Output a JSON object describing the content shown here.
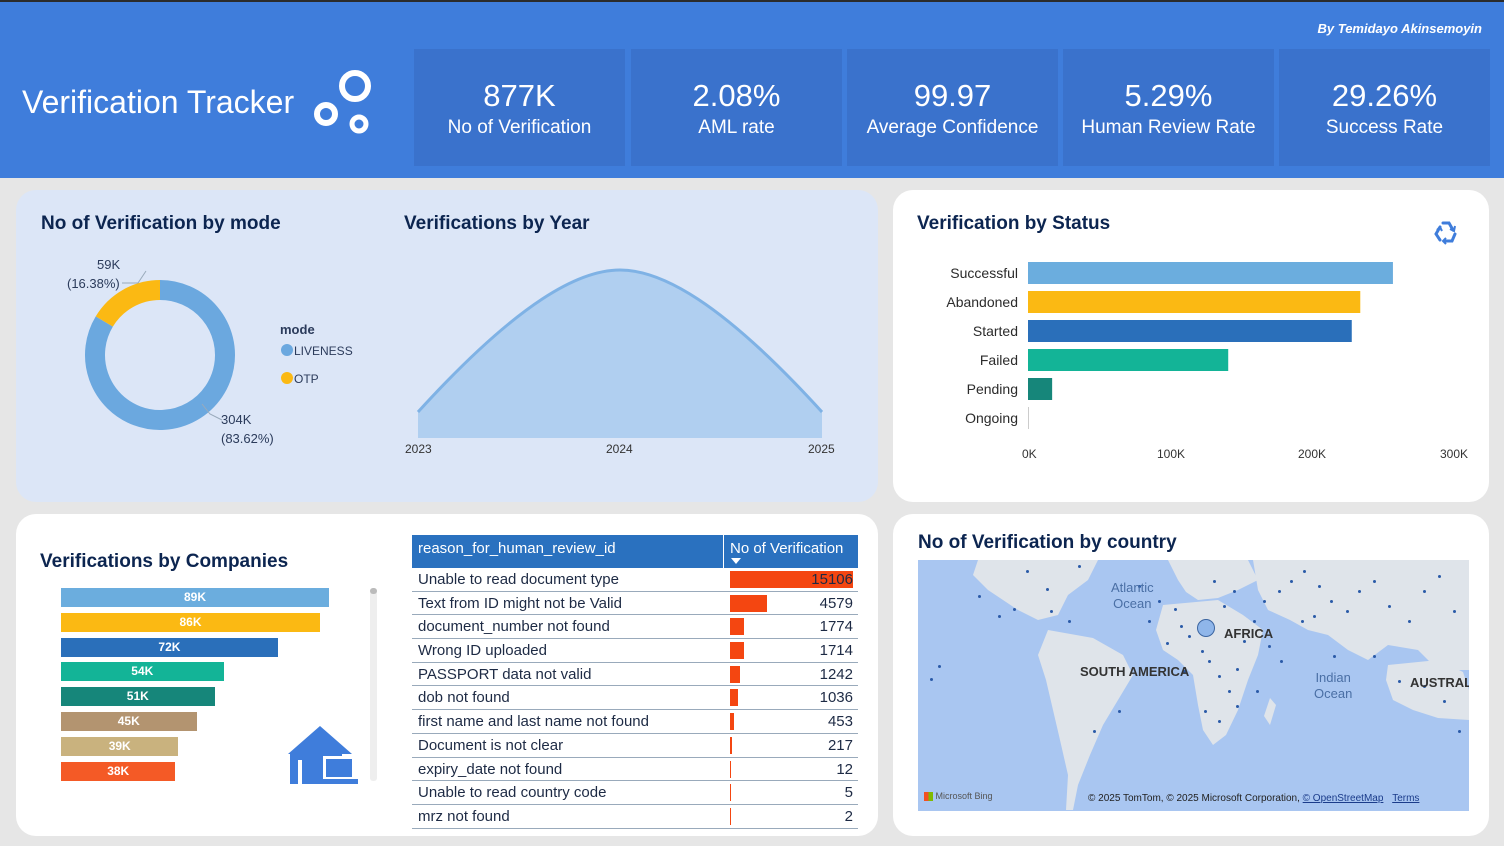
{
  "header": {
    "title": "Verification Tracker",
    "author": "By Temidayo Akinsemoyin",
    "kpis": [
      {
        "value": "877K",
        "label": "No of Verification"
      },
      {
        "value": "2.08%",
        "label": "AML rate"
      },
      {
        "value": "99.97",
        "label": "Average Confidence"
      },
      {
        "value": "5.29%",
        "label": "Human Review Rate"
      },
      {
        "value": "29.26%",
        "label": "Success Rate"
      }
    ]
  },
  "mode_chart": {
    "title": "No of Verification by mode",
    "legend_title": "mode",
    "slices": [
      {
        "name": "LIVENESS",
        "value_label": "304K",
        "pct_label": "(83.62%)",
        "pct": 83.62,
        "color": "#6ba8df"
      },
      {
        "name": "OTP",
        "value_label": "59K",
        "pct_label": "(16.38%)",
        "pct": 16.38,
        "color": "#fbb913"
      }
    ]
  },
  "year_chart": {
    "title": "Verifications by Year",
    "x_labels": [
      "2023",
      "2024",
      "2025"
    ],
    "color": "#7fb2e5"
  },
  "status_chart": {
    "title": "Verification by Status",
    "x_ticks": [
      "0K",
      "100K",
      "200K",
      "300K"
    ],
    "xlim": [
      0,
      300000
    ],
    "bars": [
      {
        "label": "Successful",
        "value": 257000,
        "color": "#6badde"
      },
      {
        "label": "Abandoned",
        "value": 234000,
        "color": "#fbb913"
      },
      {
        "label": "Started",
        "value": 228000,
        "color": "#2a6fba"
      },
      {
        "label": "Failed",
        "value": 141000,
        "color": "#13b497"
      },
      {
        "label": "Pending",
        "value": 17000,
        "color": "#16867a"
      },
      {
        "label": "Ongoing",
        "value": 300,
        "color": "#cccccc"
      }
    ]
  },
  "company_chart": {
    "title": "Verifications by Companies",
    "max": 89,
    "bars": [
      {
        "label": "89K",
        "value": 89,
        "color": "#6badde"
      },
      {
        "label": "86K",
        "value": 86,
        "color": "#fbb913"
      },
      {
        "label": "72K",
        "value": 72,
        "color": "#2a6fba"
      },
      {
        "label": "54K",
        "value": 54,
        "color": "#13b497"
      },
      {
        "label": "51K",
        "value": 51,
        "color": "#16867a"
      },
      {
        "label": "45K",
        "value": 45,
        "color": "#b39470"
      },
      {
        "label": "39K",
        "value": 39,
        "color": "#c9b27e"
      },
      {
        "label": "38K",
        "value": 38,
        "color": "#f45a26"
      }
    ]
  },
  "review_table": {
    "col1": "reason_for_human_review_id",
    "col2": "No of Verification",
    "max": 15106,
    "rows": [
      {
        "reason": "Unable to read document type",
        "count": "15106",
        "value": 15106
      },
      {
        "reason": "Text from ID might not be Valid",
        "count": "4579",
        "value": 4579
      },
      {
        "reason": "document_number not found",
        "count": "1774",
        "value": 1774
      },
      {
        "reason": "Wrong ID uploaded",
        "count": "1714",
        "value": 1714
      },
      {
        "reason": "PASSPORT data not valid",
        "count": "1242",
        "value": 1242
      },
      {
        "reason": "dob not found",
        "count": "1036",
        "value": 1036
      },
      {
        "reason": "first name and last name not found",
        "count": "453",
        "value": 453
      },
      {
        "reason": "Document is not clear",
        "count": "217",
        "value": 217
      },
      {
        "reason": "expiry_date not found",
        "count": "12",
        "value": 12
      },
      {
        "reason": "Unable to read country code",
        "count": "5",
        "value": 5
      },
      {
        "reason": "mrz not found",
        "count": "2",
        "value": 2
      }
    ]
  },
  "map": {
    "title": "No of Verification by country",
    "labels": {
      "atlantic": "Atlantic\nOcean",
      "africa": "AFRICA",
      "south_america": "SOUTH AMERICA",
      "indian": "Indian\nOcean",
      "australia": "AUSTRAL"
    },
    "attribution": "© 2025 TomTom, © 2025 Microsoft Corporation,",
    "osm_link": "© OpenStreetMap",
    "terms_link": "Terms",
    "brand": "Microsoft Bing"
  }
}
